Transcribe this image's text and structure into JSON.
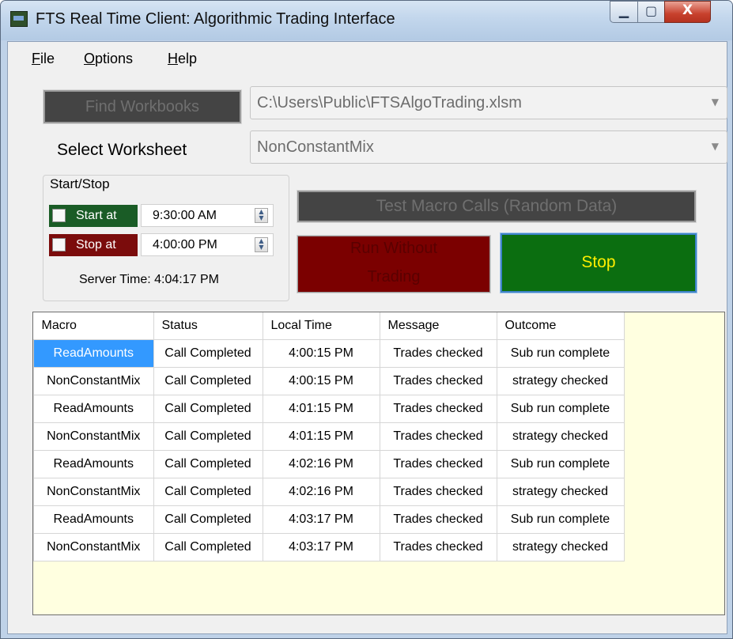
{
  "window": {
    "title": "FTS Real Time Client: Algorithmic Trading Interface",
    "controls": {
      "minimize": "▁",
      "maximize": "▢",
      "close": "X"
    }
  },
  "menu": {
    "file": {
      "u": "F",
      "rest": "ile"
    },
    "options": {
      "u": "O",
      "rest": "ptions"
    },
    "help": {
      "u": "H",
      "rest": "elp"
    }
  },
  "workbook": {
    "find_button": "Find Workbooks",
    "path": "C:\\Users\\Public\\FTSAlgoTrading.xlsm"
  },
  "worksheet": {
    "label": "Select Worksheet",
    "value": "NonConstantMix"
  },
  "startstop": {
    "group_title": "Start/Stop",
    "start_label": "Start at",
    "start_time": "9:30:00 AM",
    "stop_label": "Stop at",
    "stop_time": "4:00:00 PM",
    "server_time": "Server Time: 4:04:17 PM"
  },
  "actions": {
    "test_button": "Test Macro Calls (Random Data)",
    "run_line1": "Run Without",
    "run_line2": "Trading",
    "stop_button": "Stop"
  },
  "colors": {
    "start_bg": "#1a5c26",
    "stop_bg": "#7b0c0c",
    "run_bg": "#7b0000",
    "stop_button_bg": "#0b6e10",
    "stop_button_text": "#ffee00",
    "grid_bg": "#ffffe0",
    "selection": "#3399ff"
  },
  "table": {
    "columns": [
      "Macro",
      "Status",
      "Local Time",
      "Message",
      "Outcome"
    ],
    "rows": [
      [
        "ReadAmounts",
        "Call Completed",
        "4:00:15 PM",
        "Trades checked",
        "Sub run complete"
      ],
      [
        "NonConstantMix",
        "Call Completed",
        "4:00:15 PM",
        "Trades checked",
        "strategy checked"
      ],
      [
        "ReadAmounts",
        "Call Completed",
        "4:01:15 PM",
        "Trades checked",
        "Sub run complete"
      ],
      [
        "NonConstantMix",
        "Call Completed",
        "4:01:15 PM",
        "Trades checked",
        "strategy checked"
      ],
      [
        "ReadAmounts",
        "Call Completed",
        "4:02:16 PM",
        "Trades checked",
        "Sub run complete"
      ],
      [
        "NonConstantMix",
        "Call Completed",
        "4:02:16 PM",
        "Trades checked",
        "strategy checked"
      ],
      [
        "ReadAmounts",
        "Call Completed",
        "4:03:17 PM",
        "Trades checked",
        "Sub run complete"
      ],
      [
        "NonConstantMix",
        "Call Completed",
        "4:03:17 PM",
        "Trades checked",
        "strategy checked"
      ]
    ]
  }
}
